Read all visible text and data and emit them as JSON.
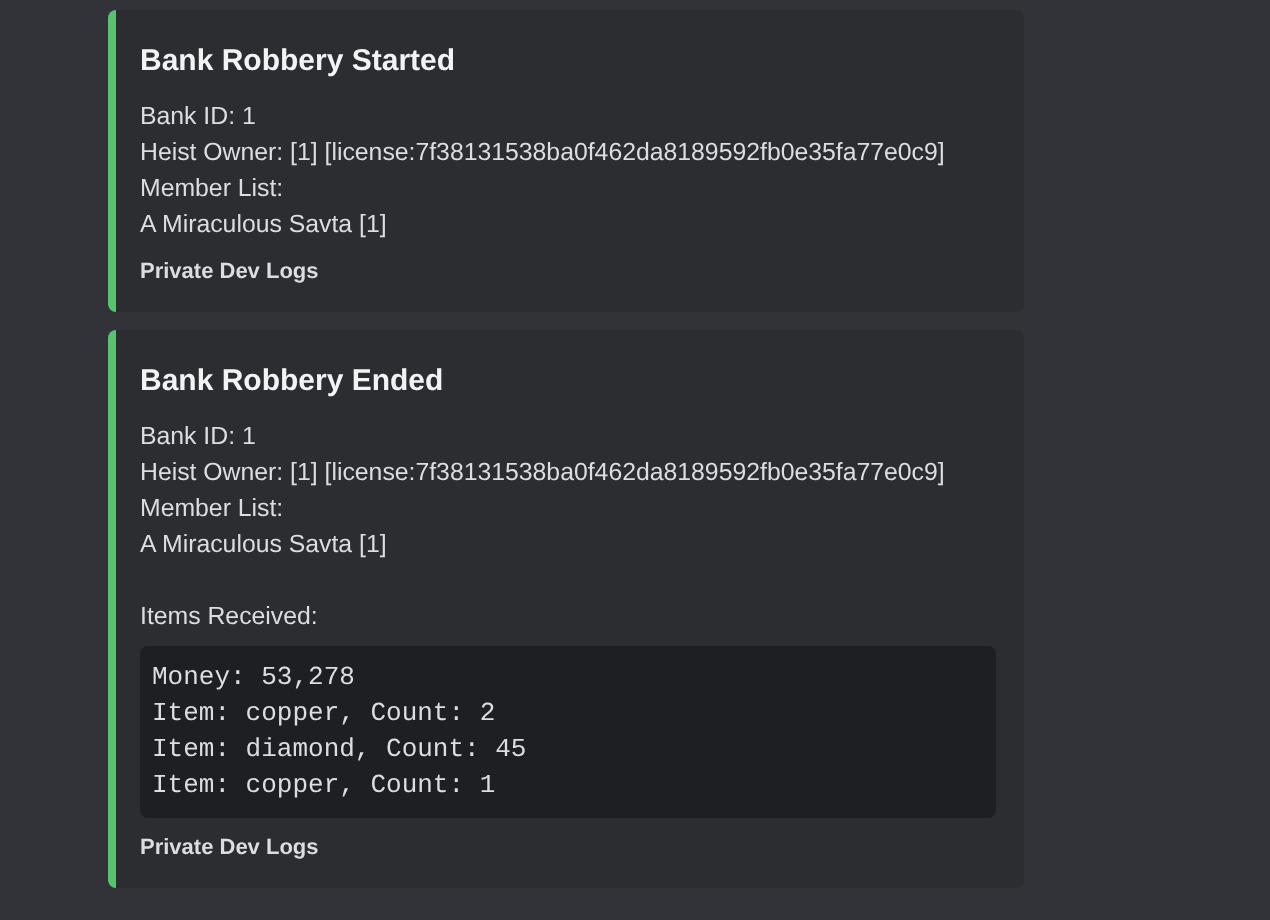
{
  "embeds": [
    {
      "color": "#57c26f",
      "title": "Bank Robbery Started",
      "lines": [
        "Bank ID: 1",
        "Heist Owner: [1] [license:7f38131538ba0f462da8189592fb0e35fa77e0c9]",
        "Member List:",
        "A Miraculous Savta [1]"
      ],
      "footer": "Private Dev Logs"
    },
    {
      "color": "#57c26f",
      "title": "Bank Robbery Ended",
      "lines": [
        "Bank ID: 1",
        "Heist Owner: [1] [license:7f38131538ba0f462da8189592fb0e35fa77e0c9]",
        "Member List:",
        "A Miraculous Savta [1]"
      ],
      "items_label": "Items Received:",
      "code_lines": [
        "Money: 53,278",
        "Item: copper, Count: 2",
        "Item: diamond, Count: 45",
        "Item: copper, Count: 1"
      ],
      "footer": "Private Dev Logs"
    }
  ]
}
